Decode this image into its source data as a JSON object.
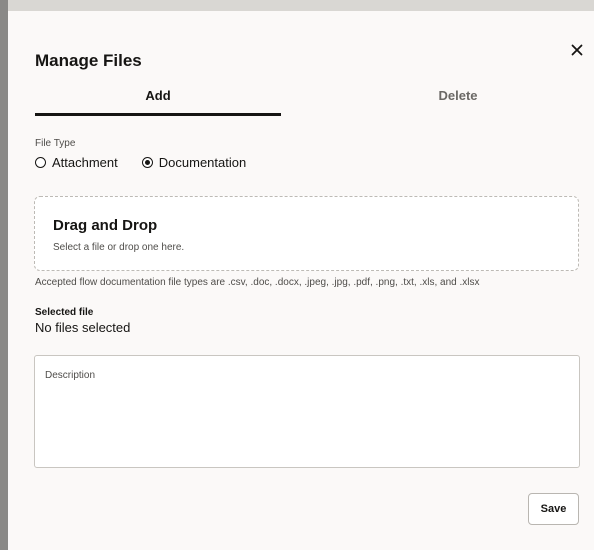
{
  "dialog": {
    "title": "Manage Files",
    "close_icon": "close-icon"
  },
  "tabs": [
    {
      "label": "Add",
      "selected": true
    },
    {
      "label": "Delete",
      "selected": false
    }
  ],
  "file_type": {
    "label": "File Type",
    "options": [
      {
        "label": "Attachment",
        "selected": false
      },
      {
        "label": "Documentation",
        "selected": true
      }
    ]
  },
  "dropzone": {
    "title": "Drag and Drop",
    "subtitle": "Select a file or drop one here."
  },
  "accepted_types": "Accepted flow documentation file types are .csv, .doc, .docx, .jpeg, .jpg, .pdf, .png, .txt, .xls, and .xlsx",
  "selected_file": {
    "label": "Selected file",
    "value": "No files selected"
  },
  "description": {
    "placeholder": "Description",
    "value": ""
  },
  "actions": {
    "save_label": "Save"
  },
  "colors": {
    "text": "#161513",
    "muted": "#4f4d4a",
    "dialog_bg": "#fbf9f8",
    "overlay": "#8a8987"
  }
}
